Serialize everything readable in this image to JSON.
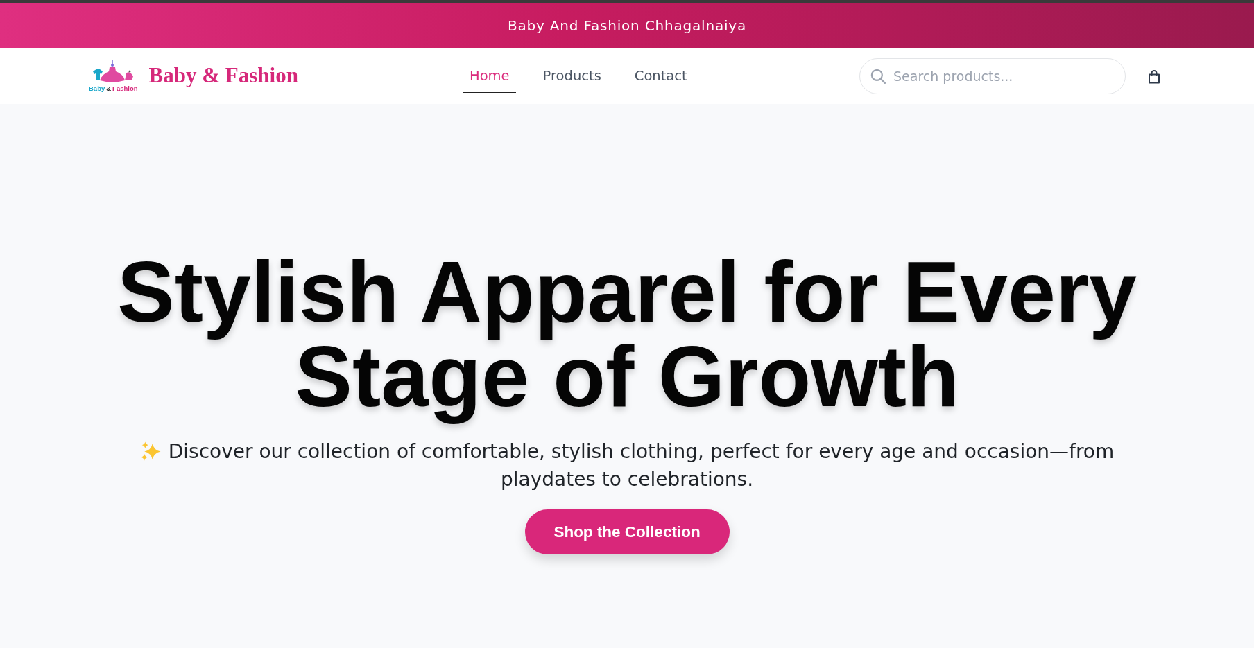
{
  "banner": {
    "text": "Baby And Fashion Chhagalnaiya"
  },
  "header": {
    "logo": {
      "caption": [
        {
          "text": "Baby",
          "color": "#1aa7c9"
        },
        {
          "text": "&",
          "color": "#2b2b2b"
        },
        {
          "text": "Fashion",
          "color": "#d6287a"
        }
      ]
    },
    "brand": "Baby & Fashion",
    "nav": [
      {
        "label": "Home",
        "selected": true
      },
      {
        "label": "Products",
        "selected": false
      },
      {
        "label": "Contact",
        "selected": false
      }
    ],
    "search": {
      "placeholder": "Search products..."
    }
  },
  "hero": {
    "title": "Stylish Apparel for Every Stage of Growth",
    "subtitle": "Discover our collection of comfortable, stylish clothing, perfect for every age and occasion—from playdates to celebrations.",
    "button": "Shop the Collection"
  }
}
